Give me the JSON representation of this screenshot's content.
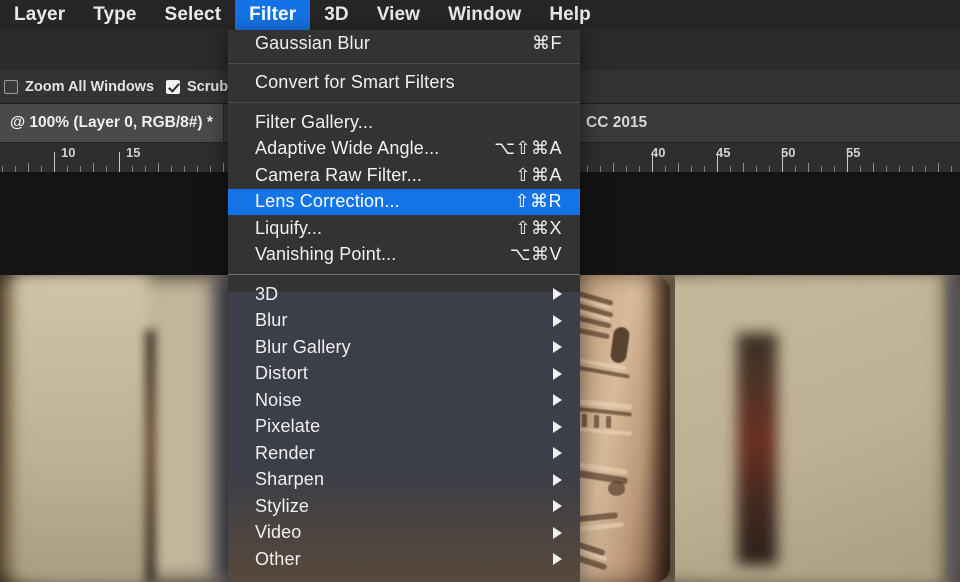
{
  "app": {
    "menubar": {
      "items": [
        {
          "label": "Layer",
          "active": false
        },
        {
          "label": "Type",
          "active": false
        },
        {
          "label": "Select",
          "active": false
        },
        {
          "label": "Filter",
          "active": true
        },
        {
          "label": "3D",
          "active": false
        },
        {
          "label": "View",
          "active": false
        },
        {
          "label": "Window",
          "active": false
        },
        {
          "label": "Help",
          "active": false
        }
      ]
    },
    "options_bar": {
      "zoom_all_windows": {
        "label": "Zoom All Windows",
        "checked": false
      },
      "scrubby_zoom": {
        "label": "Scrubby Z",
        "checked": true
      }
    },
    "document_tab": {
      "title": "@ 100% (Layer 0, RGB/8#) *",
      "version_badge": "CC 2015"
    },
    "ruler": {
      "unit_hint": "",
      "labels": [
        "10",
        "15",
        "40",
        "45",
        "50",
        "55"
      ]
    },
    "canvas": {
      "description": "Blurred museum gallery photograph with a carved stone relief sculpture in focus"
    }
  },
  "filter_menu": {
    "groups": [
      {
        "items": [
          {
            "label": "Gaussian Blur",
            "shortcut": "⌘F",
            "submenu": false,
            "selected": false
          }
        ]
      },
      {
        "items": [
          {
            "label": "Convert for Smart Filters",
            "shortcut": "",
            "submenu": false,
            "selected": false
          }
        ]
      },
      {
        "items": [
          {
            "label": "Filter Gallery...",
            "shortcut": "",
            "submenu": false,
            "selected": false
          },
          {
            "label": "Adaptive Wide Angle...",
            "shortcut": "⌥⇧⌘A",
            "submenu": false,
            "selected": false
          },
          {
            "label": "Camera Raw Filter...",
            "shortcut": "⇧⌘A",
            "submenu": false,
            "selected": false
          },
          {
            "label": "Lens Correction...",
            "shortcut": "⇧⌘R",
            "submenu": false,
            "selected": true
          },
          {
            "label": "Liquify...",
            "shortcut": "⇧⌘X",
            "submenu": false,
            "selected": false
          },
          {
            "label": "Vanishing Point...",
            "shortcut": "⌥⌘V",
            "submenu": false,
            "selected": false
          }
        ]
      },
      {
        "items": [
          {
            "label": "3D",
            "shortcut": "",
            "submenu": true,
            "selected": false
          },
          {
            "label": "Blur",
            "shortcut": "",
            "submenu": true,
            "selected": false
          },
          {
            "label": "Blur Gallery",
            "shortcut": "",
            "submenu": true,
            "selected": false
          },
          {
            "label": "Distort",
            "shortcut": "",
            "submenu": true,
            "selected": false
          },
          {
            "label": "Noise",
            "shortcut": "",
            "submenu": true,
            "selected": false
          },
          {
            "label": "Pixelate",
            "shortcut": "",
            "submenu": true,
            "selected": false
          },
          {
            "label": "Render",
            "shortcut": "",
            "submenu": true,
            "selected": false
          },
          {
            "label": "Sharpen",
            "shortcut": "",
            "submenu": true,
            "selected": false
          },
          {
            "label": "Stylize",
            "shortcut": "",
            "submenu": true,
            "selected": false
          },
          {
            "label": "Video",
            "shortcut": "",
            "submenu": true,
            "selected": false
          },
          {
            "label": "Other",
            "shortcut": "",
            "submenu": true,
            "selected": false
          }
        ]
      }
    ]
  },
  "colors": {
    "accent_highlight": "#1473e6",
    "menubar_bg": "#262626",
    "menu_bg": "#333333",
    "menu_text": "#f0f0f0",
    "chrome_bg": "#2b2b2b"
  }
}
